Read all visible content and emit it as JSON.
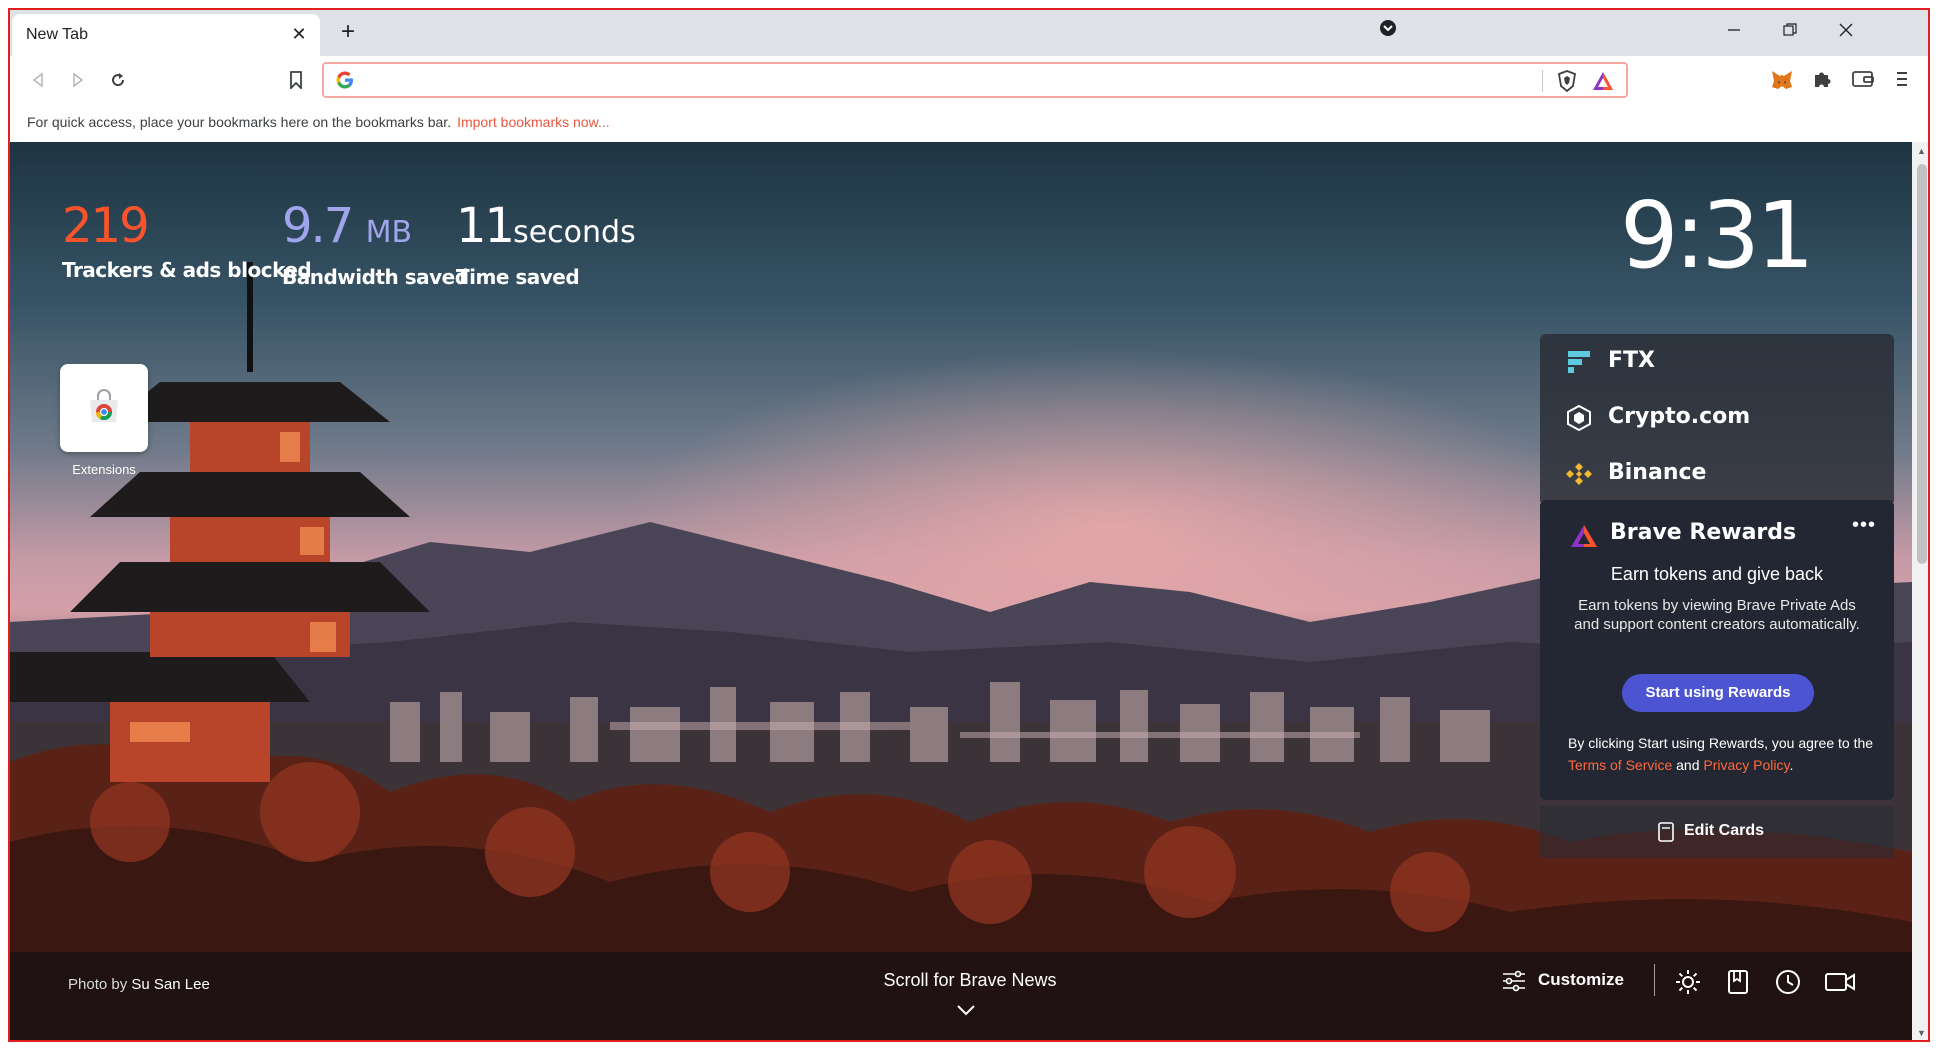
{
  "tab": {
    "title": "New Tab",
    "close_icon": "close-icon"
  },
  "window_controls": [
    "minimize",
    "restore",
    "close"
  ],
  "bookmarks_bar": {
    "message": "For quick access, place your bookmarks here on the bookmarks bar.",
    "link": "Import bookmarks now..."
  },
  "stats": {
    "trackers": {
      "value": "219",
      "label": "Trackers & ads blocked",
      "color": "#fb542b"
    },
    "bandwidth": {
      "value": "9.7",
      "unit": "MB",
      "label": "Bandwidth saved",
      "color": "#a0a5eb"
    },
    "time": {
      "value": "11",
      "unit": "seconds",
      "label": "Time saved"
    }
  },
  "clock": "9:31",
  "top_sites": [
    {
      "label": "Extensions"
    }
  ],
  "widgets": {
    "ftx": "FTX",
    "crypto": "Crypto.com",
    "binance": "Binance"
  },
  "rewards": {
    "title": "Brave Rewards",
    "more": "•••",
    "subtitle": "Earn tokens and give back",
    "description": "Earn tokens by viewing Brave Private Ads and support content creators automatically.",
    "button": "Start using Rewards",
    "terms_prefix": "By clicking Start using Rewards, you agree to the ",
    "terms_link": "Terms of Service",
    "terms_and": " and ",
    "privacy_link": "Privacy Policy",
    "terms_suffix": "."
  },
  "edit_cards": "Edit Cards",
  "photo_credit": {
    "prefix": "Photo by ",
    "author": "Su San Lee"
  },
  "scroll_news": "Scroll for Brave News",
  "customize": "Customize"
}
